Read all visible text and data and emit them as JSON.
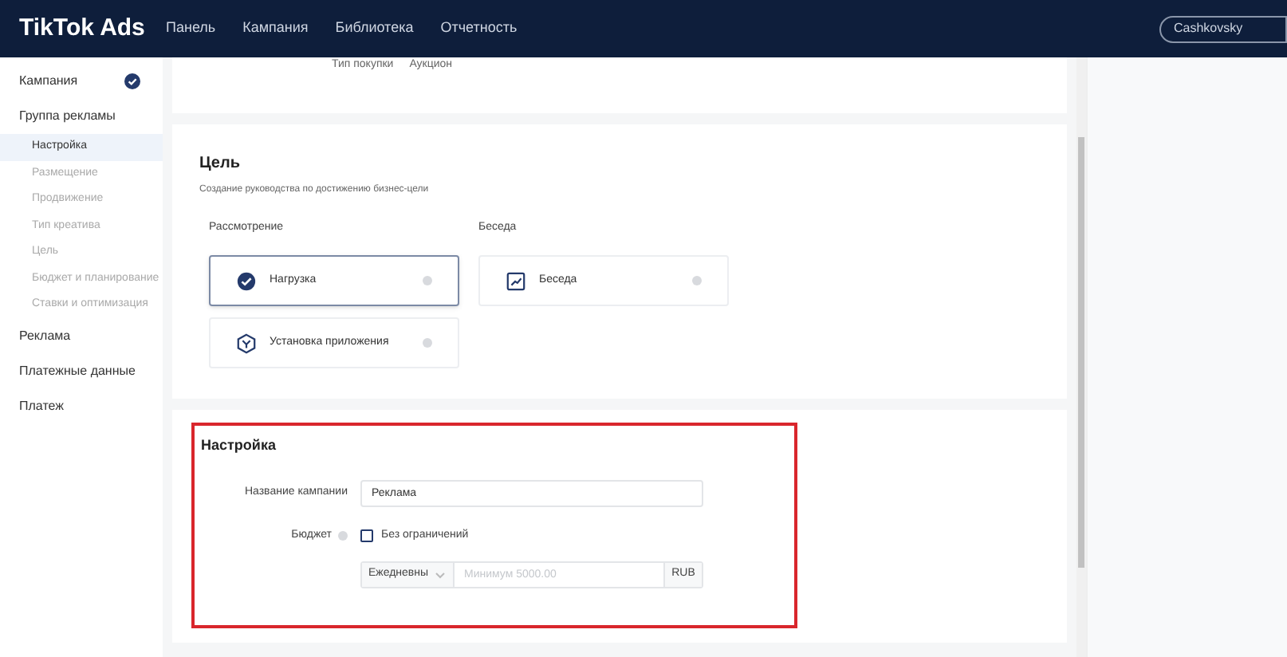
{
  "header": {
    "logo": "TikTok Ads",
    "nav": [
      {
        "label": "Панель",
        "selected": false
      },
      {
        "label": "Кампания",
        "selected": false
      },
      {
        "label": "Библиотека",
        "selected": false
      },
      {
        "label": "Отчетность",
        "selected": false
      }
    ],
    "account": "Cashkovsky"
  },
  "sidebar": {
    "items": [
      {
        "label": "Кампания",
        "completed": true
      },
      {
        "label": "Группа рекламы",
        "completed": false,
        "children": [
          {
            "label": "Настройка",
            "selected": true
          },
          {
            "label": "Размещение",
            "selected": false
          },
          {
            "label": "Продвижение",
            "selected": false
          },
          {
            "label": "Тип креатива",
            "selected": false
          },
          {
            "label": "Цель",
            "selected": false
          },
          {
            "label": "Бюджет и планирование",
            "selected": false
          },
          {
            "label": "Ставки и оптимизация",
            "selected": false
          }
        ]
      },
      {
        "label": "Реклама",
        "completed": false
      },
      {
        "label": "Платежные данные",
        "completed": false
      },
      {
        "label": "Платеж",
        "completed": false
      }
    ]
  },
  "purchase_type": {
    "label": "Тип покупки",
    "value": "Аукцион"
  },
  "goal": {
    "title": "Цель",
    "subtitle": "Создание руководства по достижению бизнес-цели",
    "groups": [
      {
        "label": "Рассмотрение",
        "options": [
          {
            "label": "Нагрузка",
            "kind": "check",
            "selected": true
          },
          {
            "label": "Установка приложения",
            "kind": "app",
            "selected": false
          }
        ]
      },
      {
        "label": "Беседа",
        "options": [
          {
            "label": "Беседа",
            "kind": "chart",
            "selected": false
          }
        ]
      }
    ]
  },
  "settings": {
    "title": "Настройка",
    "campaign_name": {
      "label": "Название кампании",
      "value": "Реклама"
    },
    "budget": {
      "label": "Бюджет",
      "unlimited": {
        "label": "Без ограничений",
        "checked": false
      },
      "period": "Ежедневны",
      "placeholder": "Минимум 5000.00",
      "currency": "RUB"
    }
  }
}
